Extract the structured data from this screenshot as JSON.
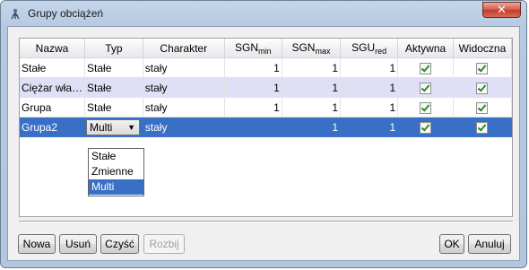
{
  "window": {
    "title": "Grupy obciążeń",
    "close_glyph": "✕"
  },
  "table": {
    "headers": {
      "name": "Nazwa",
      "type": "Typ",
      "character": "Charakter",
      "sgn_min": "SGN",
      "sgn_min_sub": "min",
      "sgn_max": "SGN",
      "sgn_max_sub": "max",
      "sgu_red": "SGU",
      "sgu_red_sub": "red",
      "active": "Aktywna",
      "visible": "Widoczna"
    },
    "rows": [
      {
        "name": "Stałe",
        "type": "Stałe",
        "character": "stały",
        "sgn_min": "1",
        "sgn_max": "1",
        "sgu_red": "1",
        "active": true,
        "visible": true
      },
      {
        "name": "Ciężar wła…",
        "type": "Stałe",
        "character": "stały",
        "sgn_min": "1",
        "sgn_max": "1",
        "sgu_red": "1",
        "active": true,
        "visible": true
      },
      {
        "name": "Grupa",
        "type": "Stałe",
        "character": "stały",
        "sgn_min": "1",
        "sgn_max": "1",
        "sgu_red": "1",
        "active": true,
        "visible": true
      },
      {
        "name": "Grupa2",
        "type": "Multi",
        "character": "stały",
        "sgn_min": "",
        "sgn_max": "1",
        "sgu_red": "1",
        "active": true,
        "visible": true
      }
    ]
  },
  "type_dropdown": {
    "options": [
      "Stałe",
      "Zmienne",
      "Multi"
    ],
    "selected": "Multi"
  },
  "buttons": {
    "new": "Nowa",
    "delete": "Usuń",
    "clear": "Czyść",
    "split": "Rozbij",
    "ok": "OK",
    "cancel": "Anuluj"
  },
  "colors": {
    "selection": "#3a6fc6",
    "alt_row": "#dfe0f5",
    "check": "#2b8a2b",
    "close": "#c23a2c"
  }
}
